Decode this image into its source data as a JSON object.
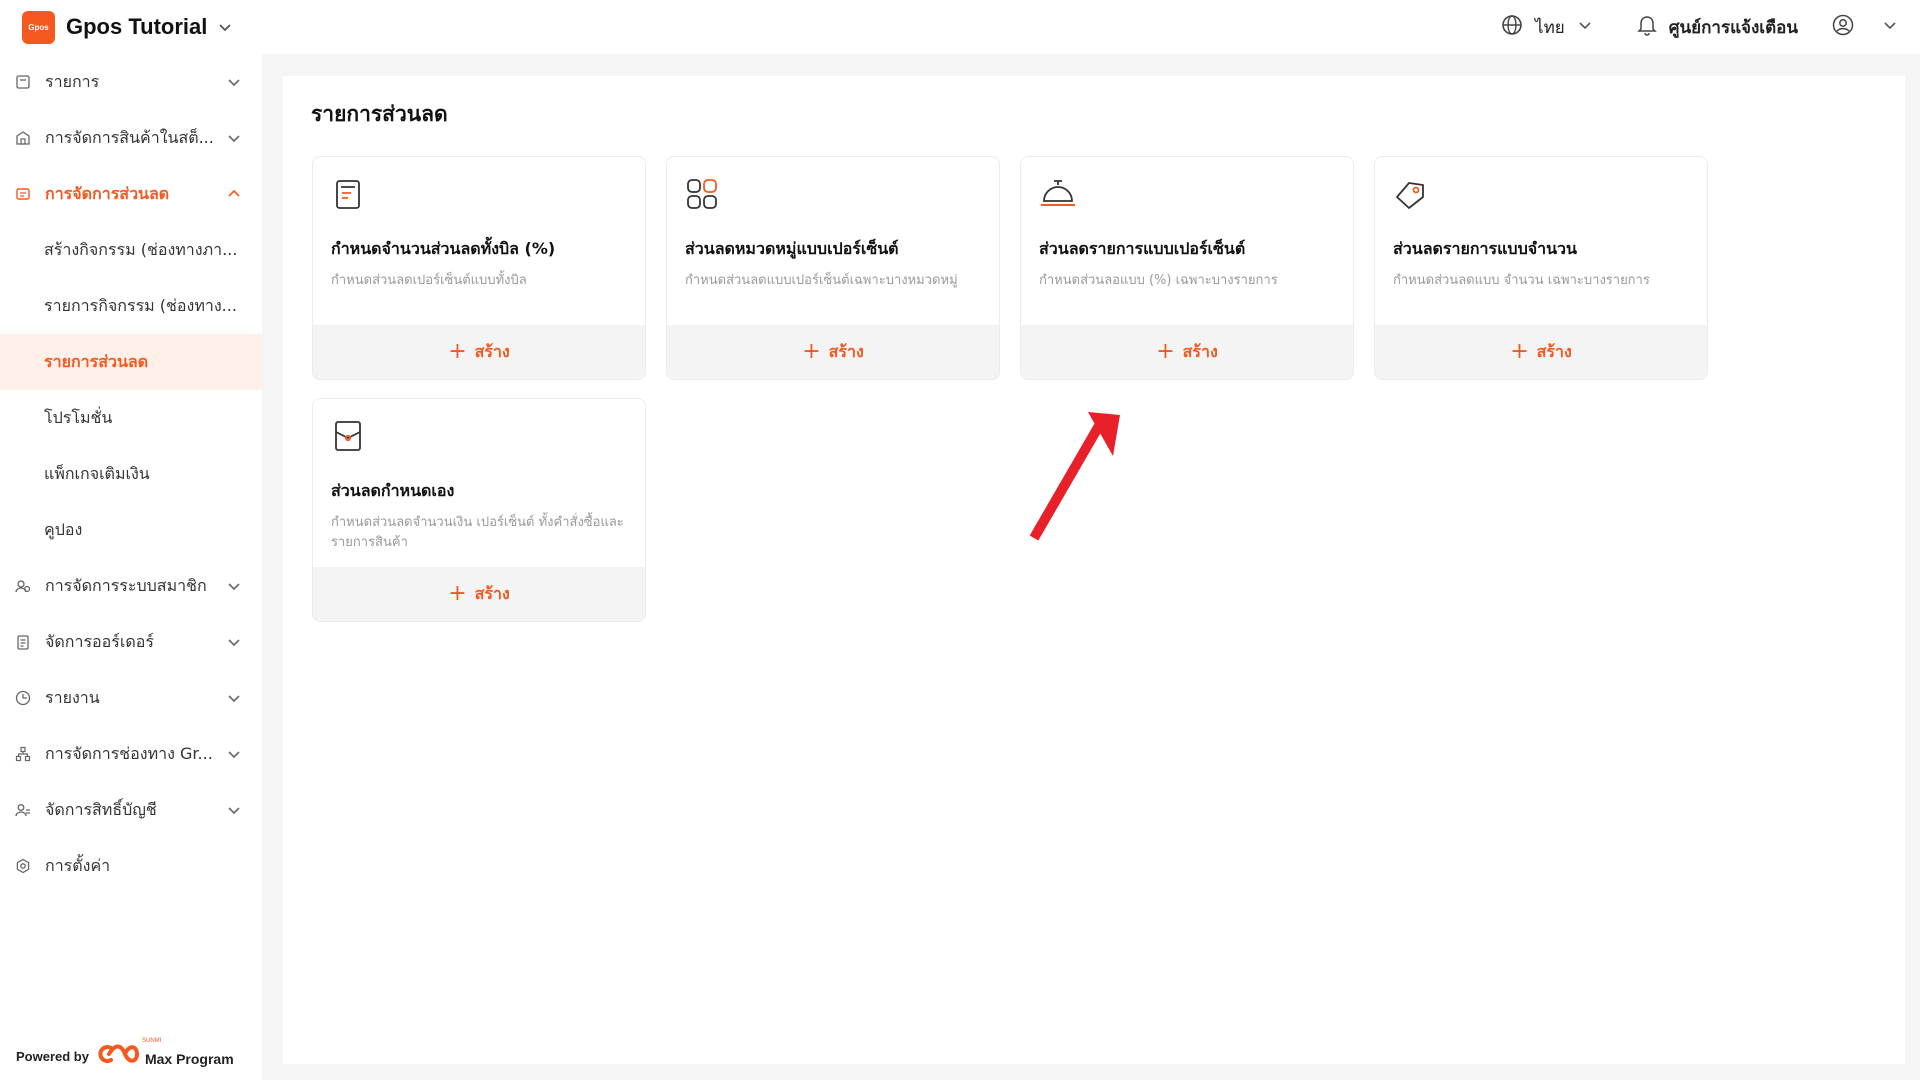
{
  "header": {
    "logo_text": "Gpos",
    "app_title": "Gpos Tutorial",
    "language": "ไทย",
    "notification_center": "ศูนย์การแจ้งเตือน"
  },
  "sidebar": {
    "items": [
      {
        "label": "รายการ",
        "icon": "list-icon"
      },
      {
        "label": "การจัดการสินค้าในสต็...",
        "icon": "store-icon"
      },
      {
        "label": "การจัดการส่วนลด",
        "icon": "coupon-icon",
        "active": true
      },
      {
        "label": "สร้างกิจกรรม (ช่องทางภา..."
      },
      {
        "label": "รายการกิจกรรม (ช่องทาง..."
      },
      {
        "label": "รายการส่วนลด",
        "selected": true
      },
      {
        "label": "โปรโมชั่น"
      },
      {
        "label": "แพ็กเกจเติมเงิน"
      },
      {
        "label": "คูปอง"
      },
      {
        "label": "การจัดการระบบสมาชิก",
        "icon": "members-icon"
      },
      {
        "label": "จัดการออร์เดอร์",
        "icon": "clipboard-icon"
      },
      {
        "label": "รายงาน",
        "icon": "clock-icon"
      },
      {
        "label": "การจัดการช่องทาง Gr...",
        "icon": "channels-icon"
      },
      {
        "label": "จัดการสิทธิ์บัญชี",
        "icon": "users-icon"
      },
      {
        "label": "การตั้งค่า",
        "icon": "settings-icon"
      }
    ],
    "powered_by": "Powered by",
    "brand_small": "SUNMI",
    "brand": "Max Program"
  },
  "main": {
    "title": "รายการส่วนลด",
    "create_label": "สร้าง",
    "cards": [
      {
        "title": "กำหนดจำนวนส่วนลดทั้งบิล (%)",
        "desc": "กำหนดส่วนลดเปอร์เซ็นต์แบบทั้งบิล",
        "icon": "receipt-icon"
      },
      {
        "title": "ส่วนลดหมวดหมู่แบบเปอร์เซ็นต์",
        "desc": "กำหนดส่วนลดแบบเปอร์เซ็นต์เฉพาะบางหมวดหมู่",
        "icon": "category-grid-icon"
      },
      {
        "title": "ส่วนลดรายการแบบเปอร์เซ็นต์",
        "desc": "กำหนดส่วนลอแบบ (%) เฉพาะบางรายการ",
        "icon": "service-bell-icon"
      },
      {
        "title": "ส่วนลดรายการแบบจำนวน",
        "desc": "กำหนดส่วนลดแบบ จำนวน เฉพาะบางรายการ",
        "icon": "price-tag-icon"
      },
      {
        "title": "ส่วนลดกำหนดเอง",
        "desc": "กำหนดส่วนลดจำนวนเงิน เปอร์เซ็นต์ ทั้งคำสั่งซื้อและรายการสินค้า",
        "icon": "envelope-icon"
      }
    ]
  },
  "colors": {
    "accent": "#f5591f",
    "annotation_arrow": "#e8202a"
  }
}
